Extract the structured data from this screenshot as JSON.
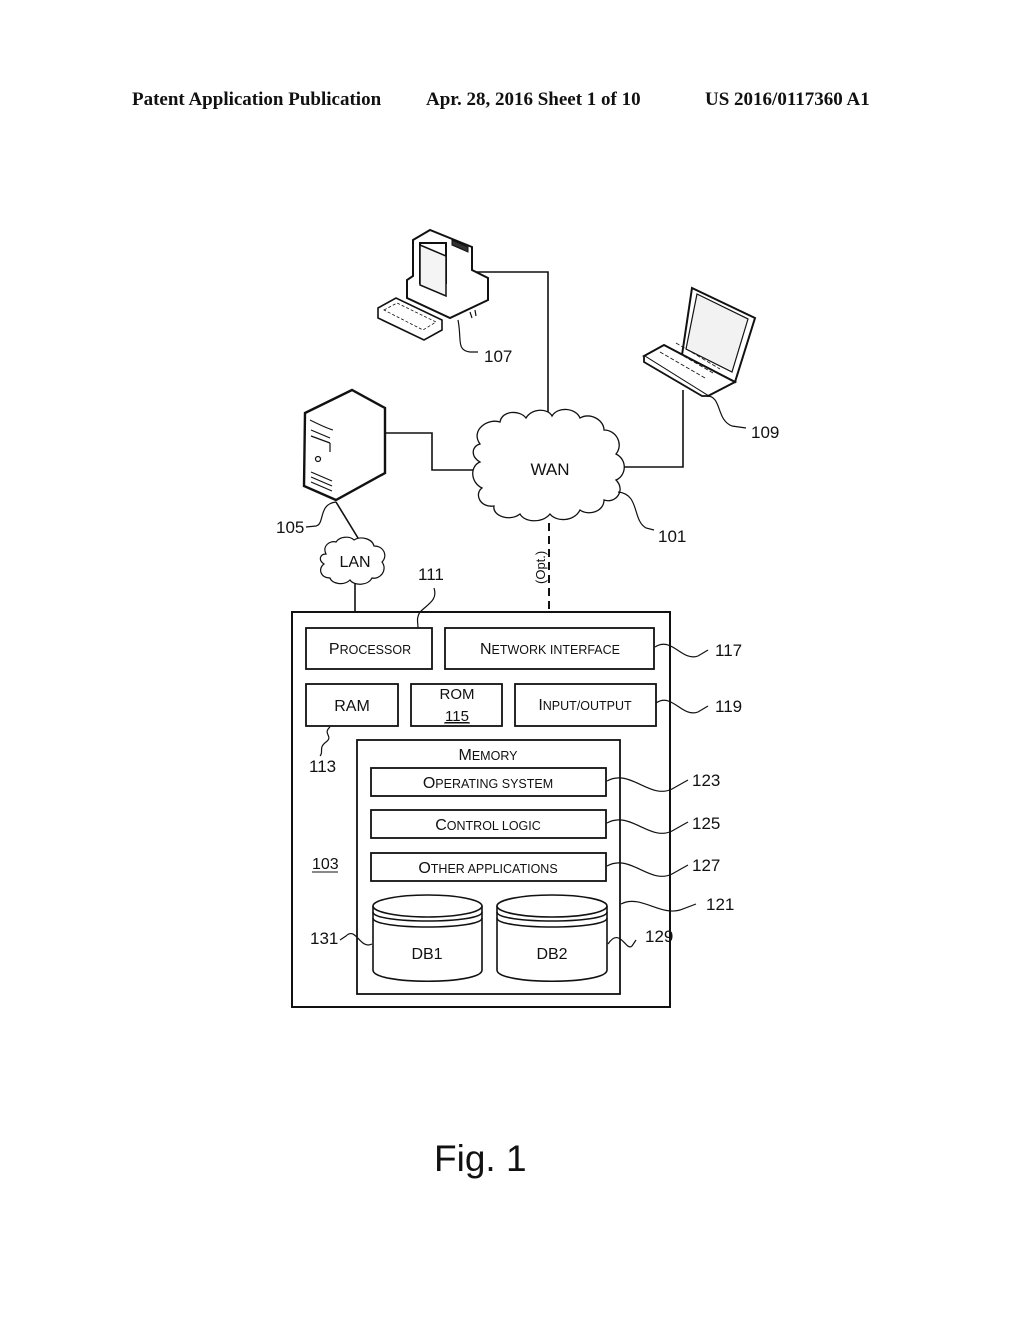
{
  "header": {
    "publication": "Patent Application Publication",
    "date_sheet": "Apr. 28, 2016  Sheet 1 of 10",
    "number": "US 2016/0117360 A1"
  },
  "figure_label": "Fig. 1",
  "network": {
    "wan": {
      "label": "WAN",
      "ref": "101"
    },
    "lan": {
      "label": "LAN"
    },
    "optional_link": "(Opt.)",
    "server_ref": "105",
    "desktop_ref": "107",
    "laptop_ref": "109"
  },
  "device": {
    "ref": "103",
    "processor": {
      "cap": "P",
      "rest": "ROCESSOR",
      "ref": "111"
    },
    "network_interface": {
      "cap1": "N",
      "rest1": "ETWORK INTERFACE",
      "ref": "117"
    },
    "ram": {
      "label": "RAM",
      "ref": "113"
    },
    "rom": {
      "label": "ROM",
      "ref": "115"
    },
    "io": {
      "cap": "I",
      "rest": "NPUT/OUTPUT",
      "ref": "119"
    },
    "memory": {
      "cap": "M",
      "rest": "EMORY",
      "ref": "121",
      "operating_system": {
        "cap": "O",
        "rest": "PERATING SYSTEM",
        "ref": "123"
      },
      "control_logic": {
        "cap": "C",
        "rest": "ONTROL LOGIC",
        "ref": "125"
      },
      "other_applications": {
        "cap": "O",
        "rest": "THER APPLICATIONS",
        "ref": "127"
      },
      "db1": {
        "label": "DB1",
        "ref": "131"
      },
      "db2": {
        "label": "DB2",
        "ref": "129"
      }
    }
  }
}
